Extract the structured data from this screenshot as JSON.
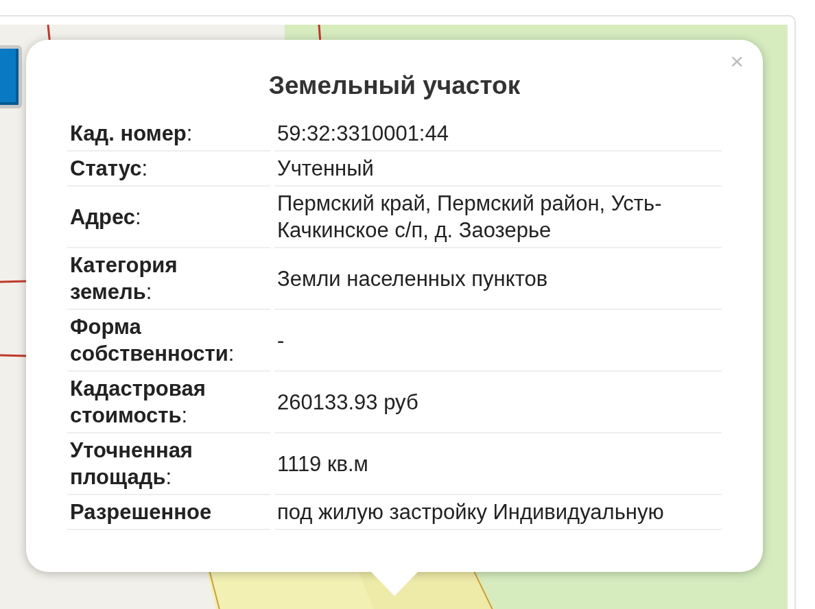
{
  "popup": {
    "title": "Земельный участок",
    "close": "×",
    "rows": [
      {
        "label": "**Кад. номер**:",
        "value": "59:32:3310001:44"
      },
      {
        "label": "**Статус**:",
        "value": "Учтенный"
      },
      {
        "label": "**Адрес**:",
        "value": "Пермский край, Пермский район, Усть-Качкинское с/п, д. Заозерье"
      },
      {
        "label": "**Категория земель**:",
        "value": "Земли населенных пунктов"
      },
      {
        "label": "**Форма собственности**:",
        "value": "-"
      },
      {
        "label": "**Кадастровая стоимость**:",
        "value": "260133.93 руб"
      },
      {
        "label": "**Уточненная площадь**:",
        "value": "1119 кв.м"
      },
      {
        "label": "**Разрешенное**",
        "value": "под жилую застройку Индивидуальную"
      }
    ]
  }
}
